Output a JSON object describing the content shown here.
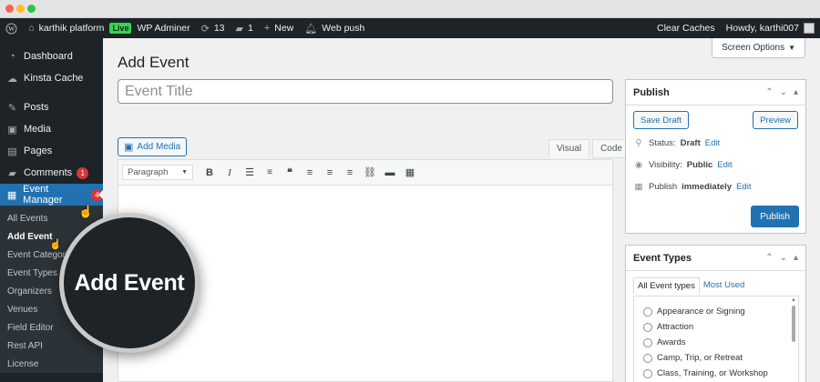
{
  "adminbar": {
    "site_name": "karthik platform",
    "live_label": "Live",
    "wp_adminer": "WP Adminer",
    "updates_count": "13",
    "comments_count": "1",
    "new_label": "New",
    "web_push": "Web push",
    "clear_caches": "Clear Caches",
    "howdy": "Howdy, karthi007"
  },
  "sidebar": {
    "items": [
      {
        "label": "Dashboard",
        "icon": "dashboard-icon"
      },
      {
        "label": "Kinsta Cache",
        "icon": "cloud-icon"
      },
      {
        "label": "Posts",
        "icon": "pin-icon"
      },
      {
        "label": "Media",
        "icon": "media-icon"
      },
      {
        "label": "Pages",
        "icon": "pages-icon"
      },
      {
        "label": "Comments",
        "icon": "comment-icon",
        "badge": "1"
      },
      {
        "label": "Event Manager",
        "icon": "calendar-icon",
        "badge": "4"
      }
    ],
    "submenu": [
      "All Events",
      "Add Event",
      "Event Categories",
      "Event Types",
      "Organizers",
      "Venues",
      "Field Editor",
      "Rest API",
      "License"
    ]
  },
  "magnifier": {
    "label": "Add Event"
  },
  "main": {
    "screen_options": "Screen Options",
    "page_title": "Add Event",
    "title_placeholder": "Event Title",
    "add_media": "Add Media",
    "tab_visual": "Visual",
    "tab_code": "Code",
    "format_select": "Paragraph"
  },
  "publish": {
    "title": "Publish",
    "save_draft": "Save Draft",
    "preview": "Preview",
    "status_label": "Status:",
    "status_value": "Draft",
    "visibility_label": "Visibility:",
    "visibility_value": "Public",
    "publish_label": "Publish",
    "publish_value": "immediately",
    "edit": "Edit",
    "publish_button": "Publish"
  },
  "event_types": {
    "title": "Event Types",
    "tab_all": "All Event types",
    "tab_most_used": "Most Used",
    "items": [
      "Appearance or Signing",
      "Attraction",
      "Awards",
      "Camp, Trip, or Retreat",
      "Class, Training, or Workshop"
    ]
  },
  "colors": {
    "accent": "#2271b1",
    "adminbar_bg": "#1d2327",
    "badge_red": "#d63638",
    "live_green": "#32d74b"
  }
}
